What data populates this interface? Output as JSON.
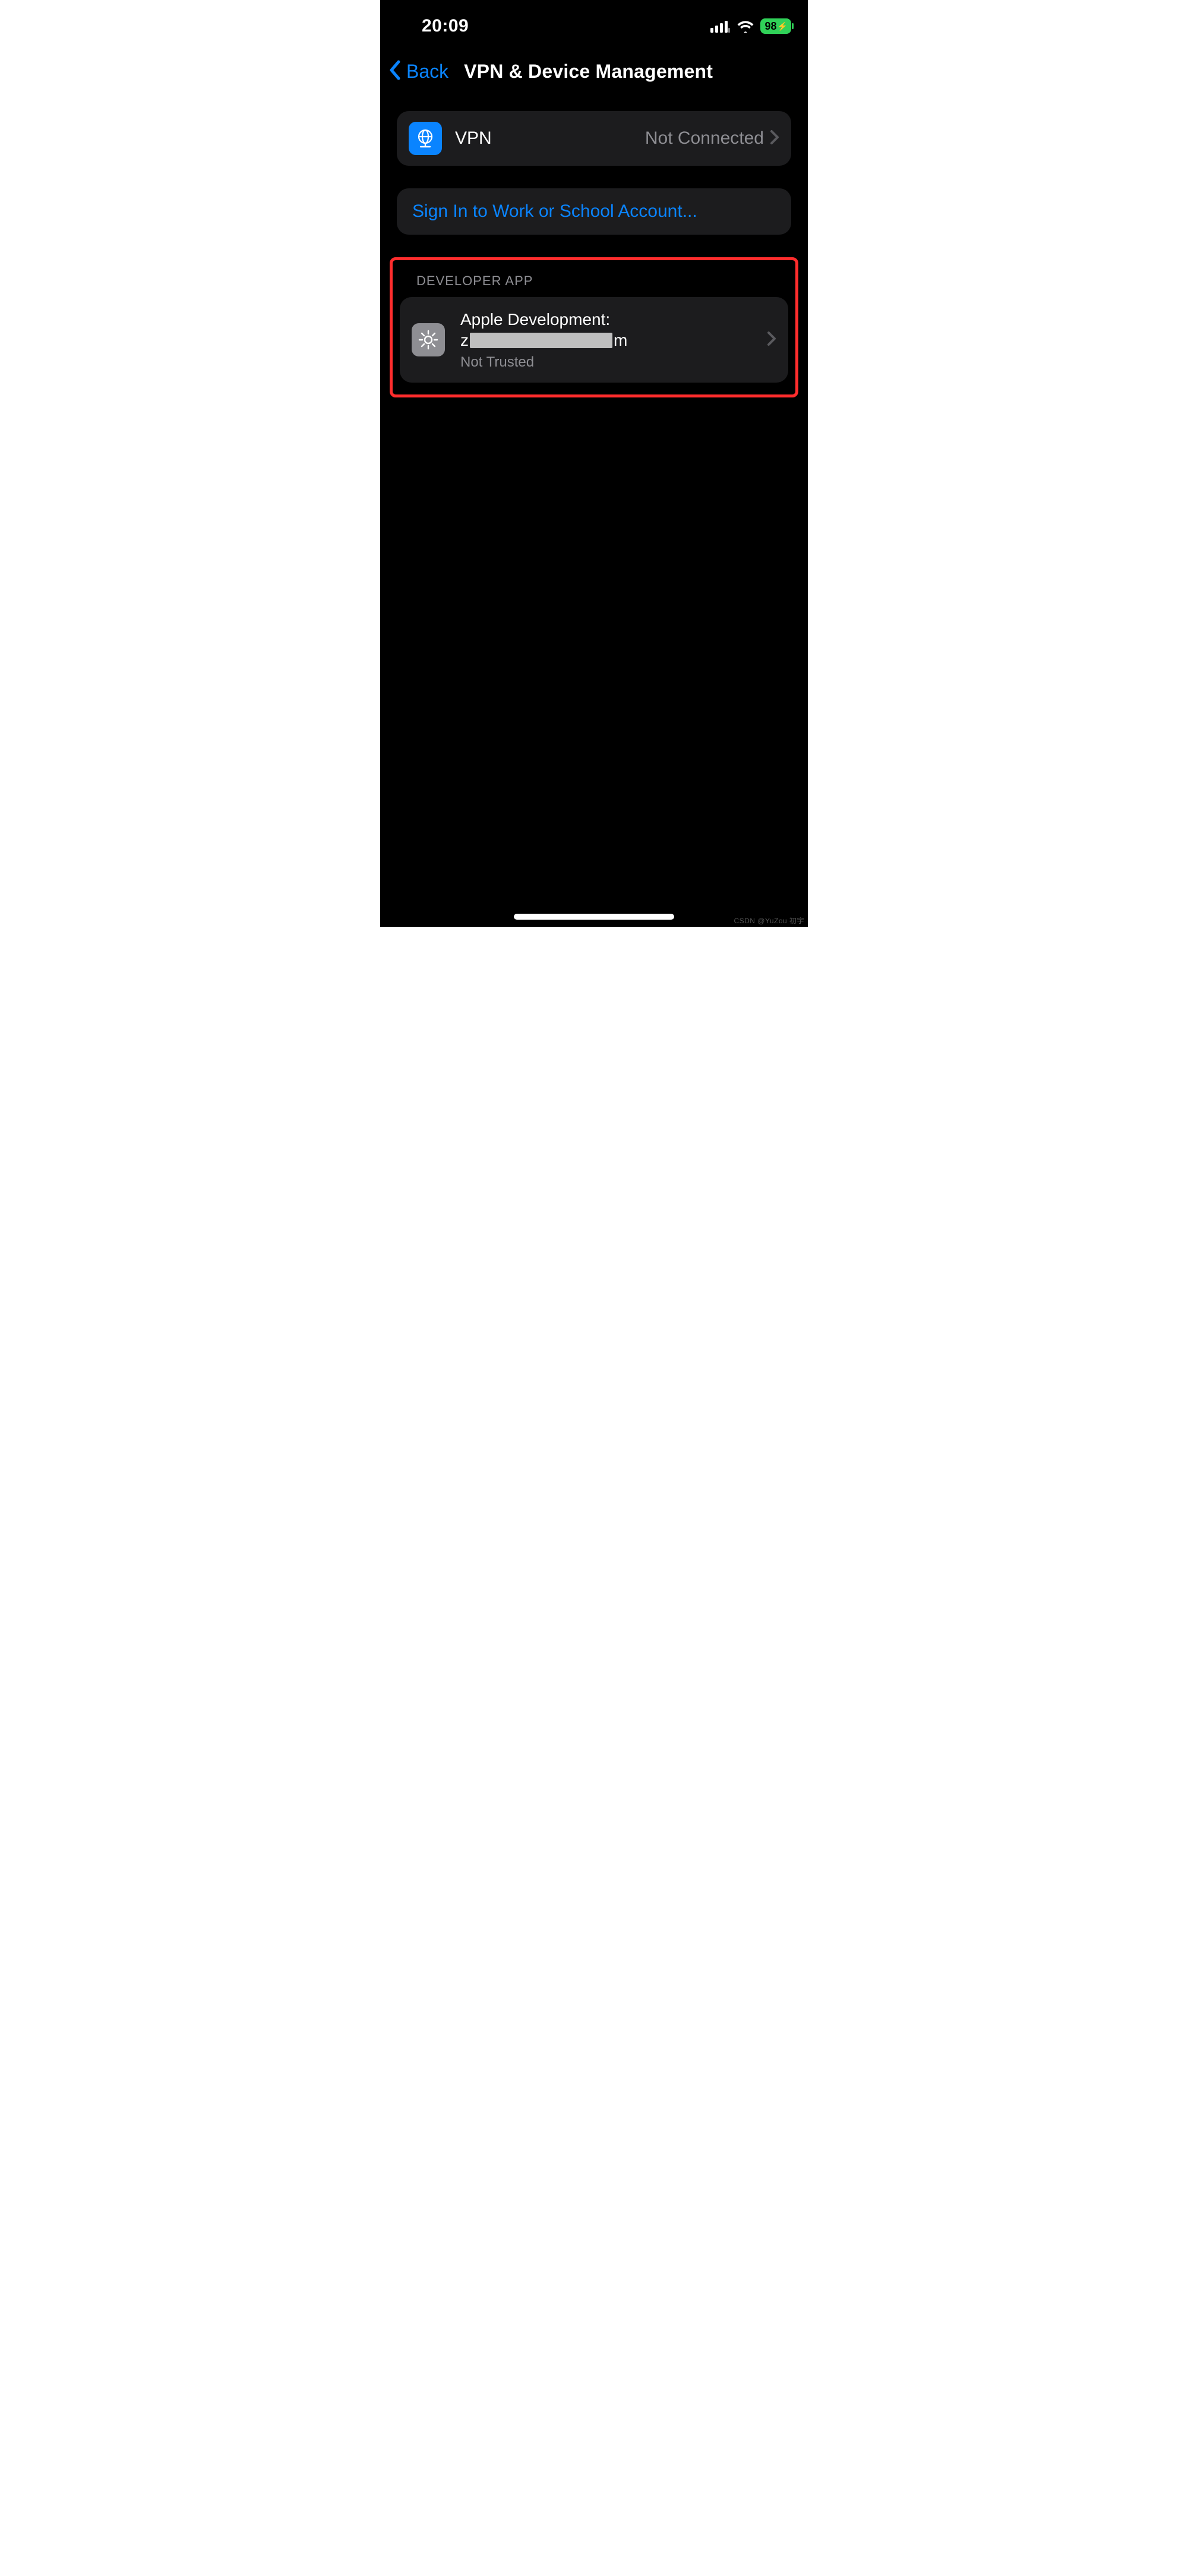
{
  "status": {
    "time": "20:09",
    "battery_text": "98"
  },
  "nav": {
    "back_label": "Back",
    "title": "VPN & Device Management"
  },
  "vpn": {
    "label": "VPN",
    "status": "Not Connected"
  },
  "signin": {
    "label": "Sign In to Work or School Account..."
  },
  "developer": {
    "section_header": "DEVELOPER APP",
    "title_line1": "Apple Development:",
    "title_line2_prefix": "z",
    "title_line2_suffix": "m",
    "subtitle": "Not Trusted"
  },
  "watermark": "CSDN @YuZou 初宇"
}
